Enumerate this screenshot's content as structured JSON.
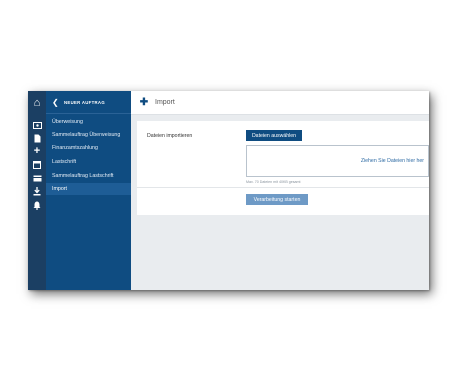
{
  "header": {
    "section_title": "NEUER AUFTRAG",
    "page_title": "Import"
  },
  "sidebar": {
    "items": [
      {
        "label": "Überweisung"
      },
      {
        "label": "Sammelauftrag Überweisung"
      },
      {
        "label": "Finanzamtszahlung"
      },
      {
        "label": "Lastschrift"
      },
      {
        "label": "Sammelauftrag Lastschrift"
      },
      {
        "label": "Import"
      }
    ],
    "active_index": 5
  },
  "iconbar": {
    "icons": [
      "home-icon",
      "wallet-icon",
      "document-icon",
      "plus-icon",
      "calendar-icon",
      "card-icon",
      "download-icon",
      "bell-icon"
    ]
  },
  "form": {
    "label": "Dateien importieren",
    "choose_button": "Dateien auswählen",
    "dropzone_text": "Ziehen Sie Dateien hier her",
    "hint": "Max. 70 Dateien mit 40KB gesamt",
    "start_button": "Verarbeitung starten"
  },
  "colors": {
    "primary": "#0f4c81",
    "iconbar": "#1b3f63",
    "active_item": "#1e5d96",
    "start_button": "#6e9ac6"
  }
}
